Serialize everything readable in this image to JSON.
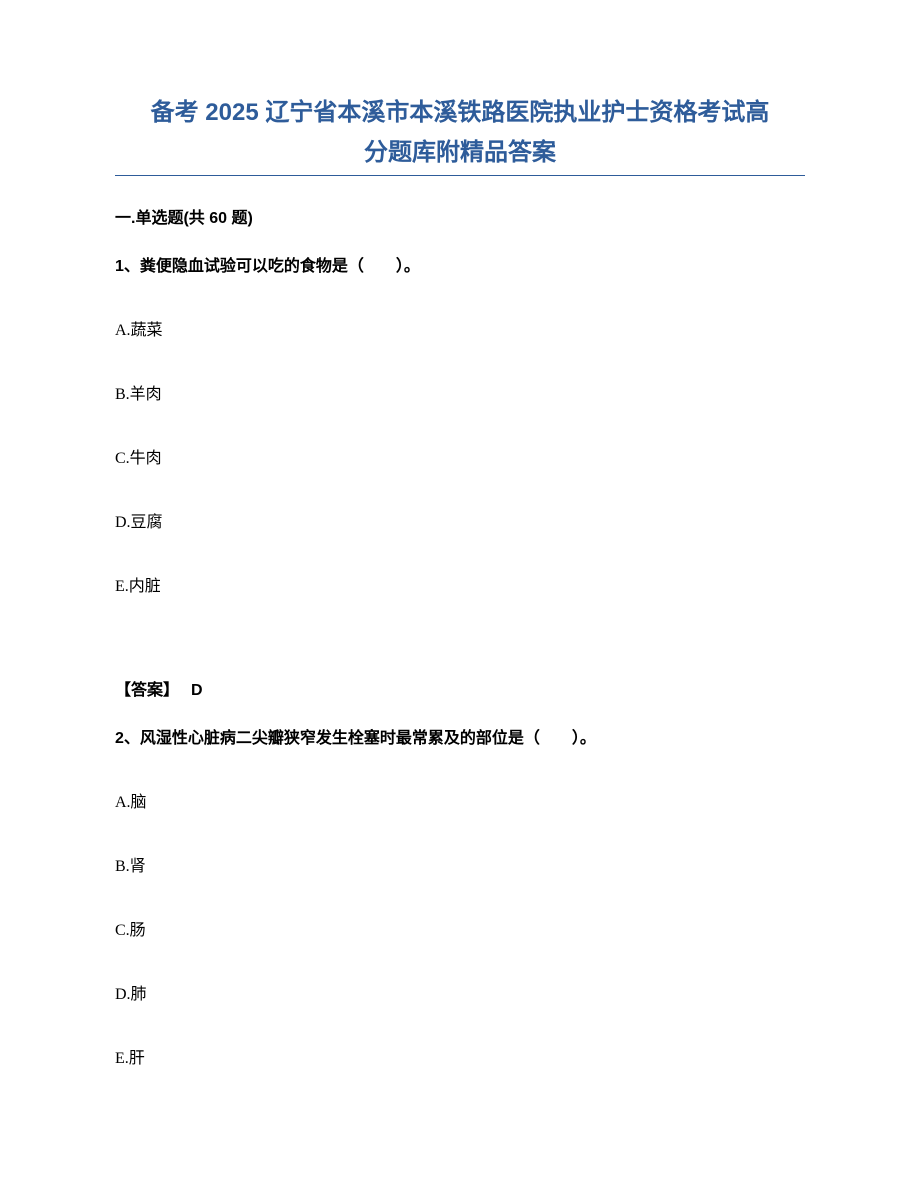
{
  "title_line1": "备考 2025 辽宁省本溪市本溪铁路医院执业护士资格考试高",
  "title_line2": "分题库附精品答案",
  "section_header": "一.单选题(共 60 题)",
  "q1": {
    "text": "1、粪便隐血试验可以吃的食物是（　　）。",
    "options": {
      "a": "A.蔬菜",
      "b": "B.羊肉",
      "c": "C.牛肉",
      "d": "D.豆腐",
      "e": "E.内脏"
    },
    "answer_label": "【答案】",
    "answer_value": "D"
  },
  "q2": {
    "text": "2、风湿性心脏病二尖瓣狭窄发生栓塞时最常累及的部位是（　　）。",
    "options": {
      "a": "A.脑",
      "b": "B.肾",
      "c": "C.肠",
      "d": "D.肺",
      "e": "E.肝"
    }
  }
}
